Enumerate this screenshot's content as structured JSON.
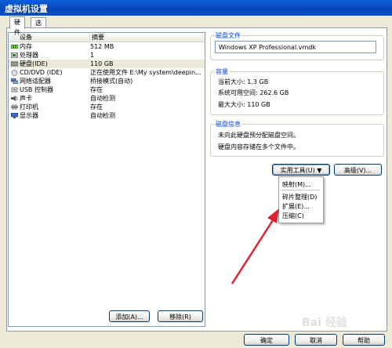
{
  "window": {
    "title": "虚拟机设置"
  },
  "tabs": [
    {
      "label": "硬件"
    },
    {
      "label": "选项"
    }
  ],
  "device_list": {
    "headers": {
      "device": "设备",
      "summary": "摘要"
    },
    "rows": [
      {
        "icon": "memory-icon",
        "device": "内存",
        "summary": "512 MB"
      },
      {
        "icon": "processor-icon",
        "device": "处理器",
        "summary": "1"
      },
      {
        "icon": "hard-disk-icon",
        "device": "硬盘(IDE)",
        "summary": "110 GB"
      },
      {
        "icon": "cd-dvd-icon",
        "device": "CD/DVD (IDE)",
        "summary": "正在使用文件 E:\\My system\\deepin..."
      },
      {
        "icon": "network-adapter-icon",
        "device": "网络适配器",
        "summary": "桥接模式(自动)"
      },
      {
        "icon": "usb-icon",
        "device": "USB 控制器",
        "summary": "存在"
      },
      {
        "icon": "sound-card-icon",
        "device": "声卡",
        "summary": "自动检测"
      },
      {
        "icon": "printer-icon",
        "device": "打印机",
        "summary": "存在"
      },
      {
        "icon": "display-icon",
        "device": "显示器",
        "summary": "自动检测"
      }
    ],
    "add_button": "添加(A)...",
    "remove_button": "移除(R)"
  },
  "disk_file": {
    "legend": "磁盘文件",
    "value": "Windows XP Professional.vmdk"
  },
  "capacity": {
    "legend": "容量",
    "current": "当前大小: 1.3 GB",
    "available": "系统可用空间: 262.6 GB",
    "max": "最大大小: 110 GB"
  },
  "disk_info": {
    "legend": "磁盘信息",
    "line1": "未向此硬盘预分配磁盘空间。",
    "line2": "硬盘内容存储在多个文件中。"
  },
  "utilities_button": "实用工具(U) ▼",
  "advanced_button": "高级(V)...",
  "utilities_menu": {
    "map": "映射(M)...",
    "defragment": "碎片整理(D)",
    "expand": "扩展(E)...",
    "compress": "压缩(C)"
  },
  "footer": {
    "ok": "确定",
    "cancel": "取消",
    "help": "帮助"
  },
  "watermark": "Bai 经验",
  "colors": {
    "title_bar": "#0a53c8",
    "arrow": "#e02030",
    "group_legend": "#0046d5"
  }
}
